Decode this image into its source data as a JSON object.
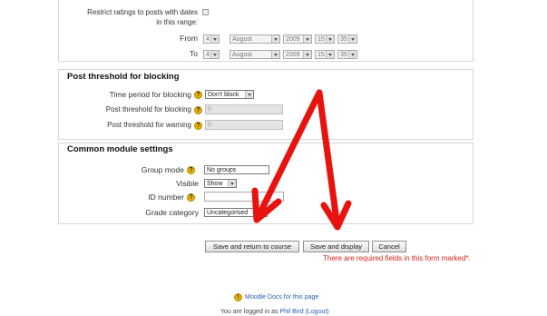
{
  "restrict": {
    "label_line1": "Restrict ratings to posts with dates",
    "label_line2": "in this range:",
    "from_label": "From",
    "to_label": "To",
    "from": {
      "day": "4",
      "month": "August",
      "year": "2009",
      "hour": "15",
      "minute": "35"
    },
    "to": {
      "day": "4",
      "month": "August",
      "year": "2009",
      "hour": "15",
      "minute": "35"
    }
  },
  "blocking": {
    "legend": "Post threshold for blocking",
    "time_period_label": "Time period for blocking",
    "time_period_value": "Don't block",
    "threshold_label": "Post threshold for blocking",
    "threshold_value": "0",
    "warning_label": "Post threshold for warning",
    "warning_value": "0"
  },
  "common": {
    "legend": "Common module settings",
    "group_mode_label": "Group mode",
    "group_mode_value": "No groups",
    "visible_label": "Visible",
    "visible_value": "Show",
    "id_number_label": "ID number",
    "id_number_value": "",
    "grade_category_label": "Grade category",
    "grade_category_value": "Uncategorised"
  },
  "buttons": {
    "save_return": "Save and return to course",
    "save_display": "Save and display",
    "cancel": "Cancel"
  },
  "required_note": "There are required fields in this form marked*.",
  "footer": {
    "docs_link": "Moodle Docs for this page",
    "logged_in_prefix": "You are logged in as",
    "user_name": "Phil Bird",
    "logout": "(Logout)"
  },
  "colors": {
    "arrow": "#e8130f",
    "required": "#d4231a",
    "help_icon": "#e8b400"
  }
}
